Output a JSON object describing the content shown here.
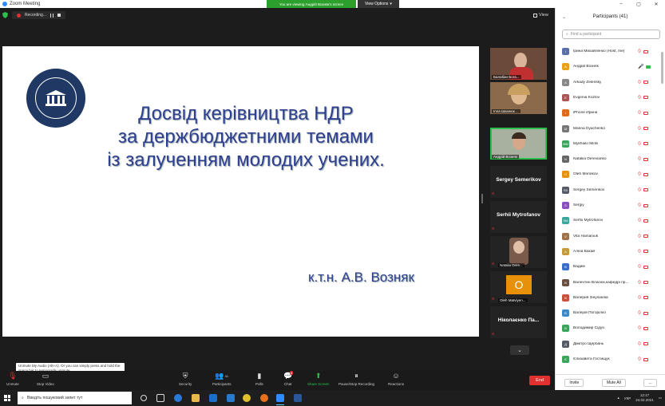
{
  "window": {
    "app_title": "Zoom Meeting",
    "viewing_banner": "You are viewing Андрій Возняк's screen",
    "view_options": "View Options",
    "view_label": "View"
  },
  "recording": {
    "label": "Recording..."
  },
  "slide": {
    "title_lines": [
      "Досвід керівництва НДР",
      "за держбюджетними темами",
      "із залученням молодих учених."
    ],
    "author": "к.т.н. А.В. Возняк"
  },
  "thumbnails": [
    {
      "name": "Балабан Бога...",
      "type": "video"
    },
    {
      "name": "Inna Шахнюк ...",
      "type": "video"
    },
    {
      "name": "Андрій Возняк",
      "type": "video",
      "active": true
    },
    {
      "name": "Sergey Semerikov",
      "type": "name"
    },
    {
      "name": "Serhii Mytrofanov",
      "type": "name"
    },
    {
      "name": "Natalia Dere...",
      "type": "photo"
    },
    {
      "name": "Oleh Matviyen...",
      "type": "initial",
      "initial": "O"
    },
    {
      "name": "Ніколаєнко Па...",
      "type": "name"
    }
  ],
  "tooltip": "Unmute My Audio (Alt+A). Or you can simply press and hold the space bar to temporarily unmute.",
  "controls": {
    "unmute": "Unmute",
    "stop_video": "Stop Video",
    "security": "Security",
    "participants": "Participants",
    "participants_count": "41",
    "polls": "Polls",
    "chat": "Chat",
    "chat_badge": "4",
    "share_screen": "Share Screen",
    "pause_recording": "Pause/Stop Recording",
    "reactions": "Reactions",
    "end": "End"
  },
  "panel": {
    "title": "Participants (41)",
    "search_placeholder": "Find a participant",
    "invite": "Invite",
    "mute_all": "Mute All",
    "more": "...",
    "participants": [
      {
        "name": "Ірина Михайленко (Host, me)",
        "initial": "І",
        "color": "#5a6fa8",
        "mic": "off",
        "cam": "off"
      },
      {
        "name": "Андрій Возняк",
        "initial": "А",
        "color": "#e8a21a",
        "mic": "on",
        "cam": "on"
      },
      {
        "name": "Arkady Zelensky",
        "initial": "A",
        "color": "#888888",
        "mic": "off",
        "cam": "off"
      },
      {
        "name": "Evgenia Kozlov",
        "initial": "E",
        "color": "#a55",
        "mic": "off",
        "cam": "off"
      },
      {
        "name": "iPhone Ирина",
        "initial": "i",
        "color": "#e06a1a",
        "mic": "off",
        "cam": "off"
      },
      {
        "name": "Marina Dyachenko",
        "initial": "M",
        "color": "#777777",
        "mic": "off",
        "cam": "off"
      },
      {
        "name": "Mykhailo Mintii",
        "initial": "MM",
        "color": "#3aa55a",
        "mic": "off",
        "cam": "off"
      },
      {
        "name": "Nataliia Derevianko",
        "initial": "N",
        "color": "#666666",
        "mic": "off",
        "cam": "off"
      },
      {
        "name": "Oleh Moroikov",
        "initial": "O",
        "color": "#e8900a",
        "mic": "off",
        "cam": "off"
      },
      {
        "name": "Sergey Semerikov",
        "initial": "SS",
        "color": "#555a66",
        "mic": "off",
        "cam": "off"
      },
      {
        "name": "Sergiy",
        "initial": "S",
        "color": "#8a4fbf",
        "mic": "off",
        "cam": "off"
      },
      {
        "name": "Serhii Mytrofanov",
        "initial": "SM",
        "color": "#3aa59a",
        "mic": "off",
        "cam": "off"
      },
      {
        "name": "Vita Hamaniuk",
        "initial": "V",
        "color": "#a0724a",
        "mic": "off",
        "cam": "off"
      },
      {
        "name": "Аліна Бакай",
        "initial": "А",
        "color": "#c49a3a",
        "mic": "off",
        "cam": "off"
      },
      {
        "name": "Вадим",
        "initial": "В",
        "color": "#3a6fc9",
        "mic": "off",
        "cam": "off"
      },
      {
        "name": "Валентин Власюк,кафедрі пр...",
        "initial": "В",
        "color": "#6a5040",
        "mic": "off",
        "cam": "off"
      },
      {
        "name": "Валерия Зінуліаєва",
        "initial": "В",
        "color": "#c9503a",
        "mic": "off",
        "cam": "off"
      },
      {
        "name": "Валерій Погорілко",
        "initial": "В",
        "color": "#3a8ac9",
        "mic": "off",
        "cam": "off"
      },
      {
        "name": "Володимир Сідун",
        "initial": "В",
        "color": "#3aa55a",
        "mic": "off",
        "cam": "off"
      },
      {
        "name": "Дмитро Щербань",
        "initial": "Д",
        "color": "#555a66",
        "mic": "off",
        "cam": "off"
      },
      {
        "name": "Єлизавета Гостищук",
        "initial": "Є",
        "color": "#3aa55a",
        "mic": "off",
        "cam": "off"
      }
    ]
  },
  "taskbar": {
    "search_placeholder": "Введіть пошуковий запит тут",
    "time": "12:17",
    "date": "24.02.2021",
    "lang": "УКР"
  }
}
